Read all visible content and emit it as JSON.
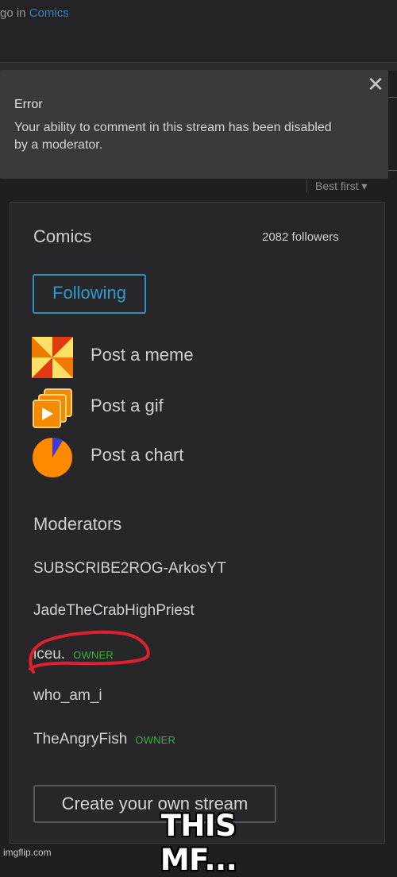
{
  "header": {
    "prefix": "go in",
    "stream_link": "Comics"
  },
  "error": {
    "title": "Error",
    "message": "Your ability to comment in this stream has been disabled by a moderator.",
    "close_glyph": "✕"
  },
  "sort": {
    "label": "Best first",
    "arrow": "▾"
  },
  "panel": {
    "stream_name": "Comics",
    "followers": "2082 followers",
    "follow_button": "Following",
    "post_actions": [
      {
        "label": "Post a meme",
        "icon": "meme-icon"
      },
      {
        "label": "Post a gif",
        "icon": "gif-icon"
      },
      {
        "label": "Post a chart",
        "icon": "chart-icon"
      }
    ],
    "moderators_title": "Moderators",
    "moderators": [
      {
        "name": "SUBSCRIBE2ROG-ArkosYT",
        "badge": ""
      },
      {
        "name": "JadeTheCrabHighPriest",
        "badge": ""
      },
      {
        "name": "iceu.",
        "badge": "OWNER"
      },
      {
        "name": "who_am_i",
        "badge": ""
      },
      {
        "name": "TheAngryFish",
        "badge": "OWNER"
      }
    ],
    "create_button": "Create your own stream"
  },
  "meme_caption": "THIS MF...",
  "watermark": "imgflip.com",
  "colors": {
    "accent": "#2f9ad0",
    "owner_green": "#3fae3f",
    "annotation_red": "#e0202c",
    "background": "#1f1f22"
  }
}
